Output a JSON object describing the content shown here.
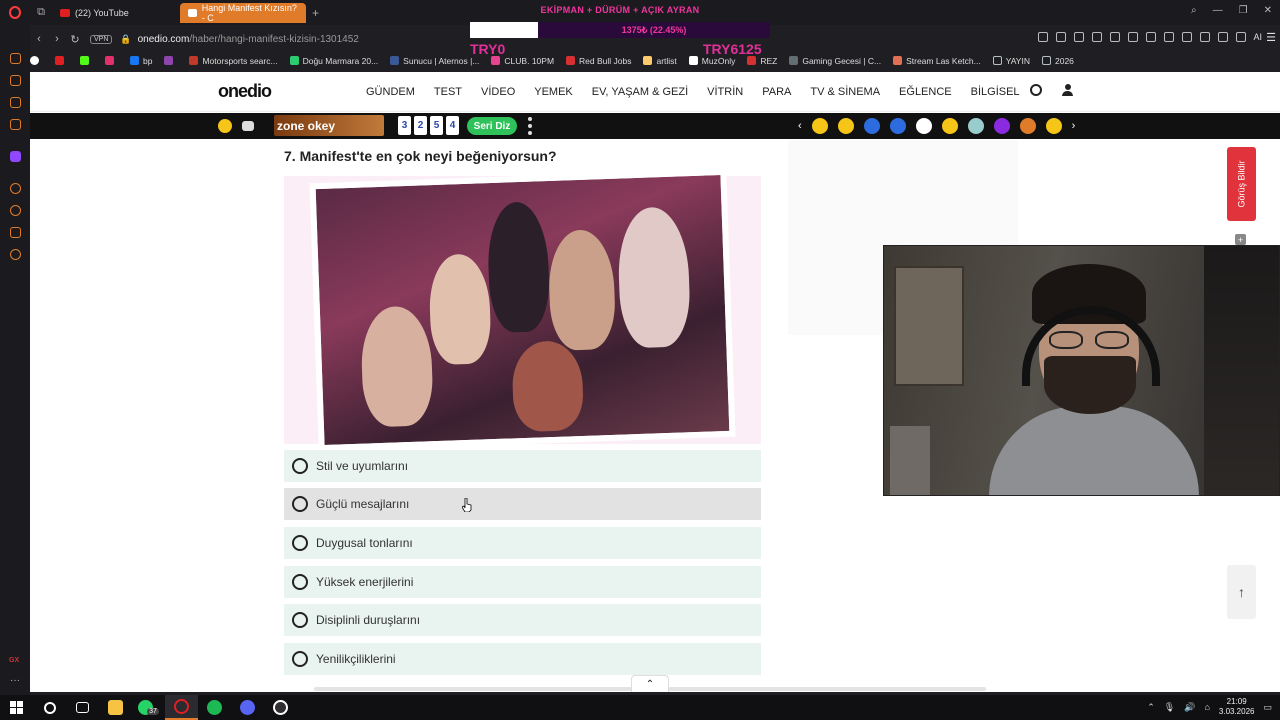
{
  "browser": {
    "tabs": [
      {
        "label": "(22) YouTube",
        "color": "#e02020"
      },
      {
        "label": "Hangi Manifest Kızısın? - C",
        "color": "#ffffff"
      }
    ],
    "url_domain": "onedio.com",
    "url_path": "/haber/hangi-manifest-kizisin-1301452",
    "vpn_label": "VPN",
    "ai_label": "AI",
    "bookmarks": [
      {
        "label": "bp",
        "color": "#1877f2"
      },
      {
        "label": "Motorsports searc...",
        "color": "#c0392b"
      },
      {
        "label": "Doğu Marmara 20...",
        "color": "#2ecc71"
      },
      {
        "label": "Sunucu | Aternos |...",
        "color": "#3b5998"
      },
      {
        "label": "CLUB. 10PM",
        "color": "#e84393"
      },
      {
        "label": "Red Bull Jobs",
        "color": "#d63031"
      },
      {
        "label": "artlist",
        "color": "#fdcb6e"
      },
      {
        "label": "MuzOnly",
        "color": "#ffffff"
      },
      {
        "label": "REZ",
        "color": "#d63031"
      },
      {
        "label": "Gaming Gecesi | C...",
        "color": "#2d3436"
      },
      {
        "label": "Stream Las Ketch...",
        "color": "#e17055"
      },
      {
        "label": "YAYIN",
        "color": "#b2bec3"
      },
      {
        "label": "2026",
        "color": "#b2bec3"
      }
    ]
  },
  "stream_overlay": {
    "goal_title": "EKİPMAN + DÜRÜM + AÇIK AYRAN",
    "goal_progress_text": "1375₺ (22.45%)",
    "goal_progress": 0.2245,
    "goal_min": "TRY0",
    "goal_max": "TRY6125"
  },
  "site": {
    "logo": "onedio",
    "nav": [
      "GÜNDEM",
      "TEST",
      "VİDEO",
      "YEMEK",
      "EV, YAŞAM & GEZİ",
      "VİTRİN",
      "PARA",
      "TV & SİNEMA",
      "EĞLENCE",
      "BİLGİSEL"
    ],
    "zone_label": "zone okey",
    "tiles": [
      "3",
      "2",
      "5",
      "4"
    ],
    "seri_button": "Seri Diz",
    "feedback_label": "Görüş Bildir"
  },
  "question": {
    "title": "7. Manifest'te en çok neyi beğeniyorsun?",
    "options": [
      "Stil ve uyumlarını",
      "Güçlü mesajlarını",
      "Duygusal tonlarını",
      "Yüksek enerjilerini",
      "Disiplinli duruşlarını",
      "Yenilikçiliklerini"
    ],
    "hovered_option": 1
  },
  "taskbar": {
    "whatsapp_badge": "37",
    "time": "21:09",
    "date": "3.03.2026"
  }
}
